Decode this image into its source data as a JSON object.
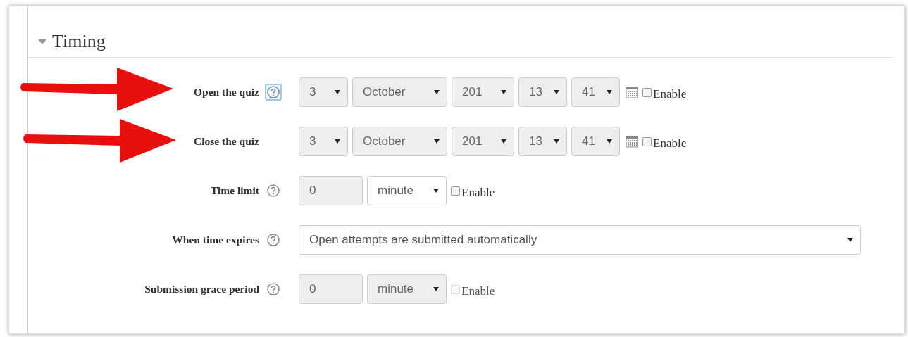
{
  "section": {
    "title": "Timing",
    "expanded": true
  },
  "rows": [
    {
      "kind": "datetime",
      "label": "Open the quiz",
      "arrow": true,
      "help": true,
      "help_focused": true,
      "fields": [
        {
          "value": "3",
          "disabled": true
        },
        {
          "value": "October",
          "disabled": true
        },
        {
          "value": "201",
          "disabled": true
        },
        {
          "value": "13",
          "disabled": true
        },
        {
          "value": "41",
          "disabled": true
        }
      ],
      "enable": {
        "label": "Enable",
        "checked": false,
        "disabled": false
      }
    },
    {
      "kind": "datetime",
      "label": "Close the quiz",
      "arrow": true,
      "help": false,
      "fields": [
        {
          "value": "3",
          "disabled": true
        },
        {
          "value": "October",
          "disabled": true
        },
        {
          "value": "201",
          "disabled": true
        },
        {
          "value": "13",
          "disabled": true
        },
        {
          "value": "41",
          "disabled": true
        }
      ],
      "enable": {
        "label": "Enable",
        "checked": false,
        "disabled": false
      }
    },
    {
      "kind": "duration",
      "label": "Time limit",
      "help": true,
      "help_focused": false,
      "fields": [
        {
          "value": "0",
          "disabled": true
        },
        {
          "value": "minute",
          "disabled": false
        }
      ],
      "enable": {
        "label": "Enable",
        "checked": false,
        "disabled": false
      }
    },
    {
      "kind": "select",
      "label": "When time expires",
      "help": true,
      "help_focused": false,
      "fields": [
        {
          "value": "Open attempts are submitted automatically",
          "disabled": false
        }
      ]
    },
    {
      "kind": "duration",
      "label": "Submission grace period",
      "help": true,
      "help_focused": false,
      "fields": [
        {
          "value": "0",
          "disabled": true
        },
        {
          "value": "minute",
          "disabled": true
        }
      ],
      "enable": {
        "label": "Enable",
        "checked": false,
        "disabled": true
      }
    }
  ]
}
